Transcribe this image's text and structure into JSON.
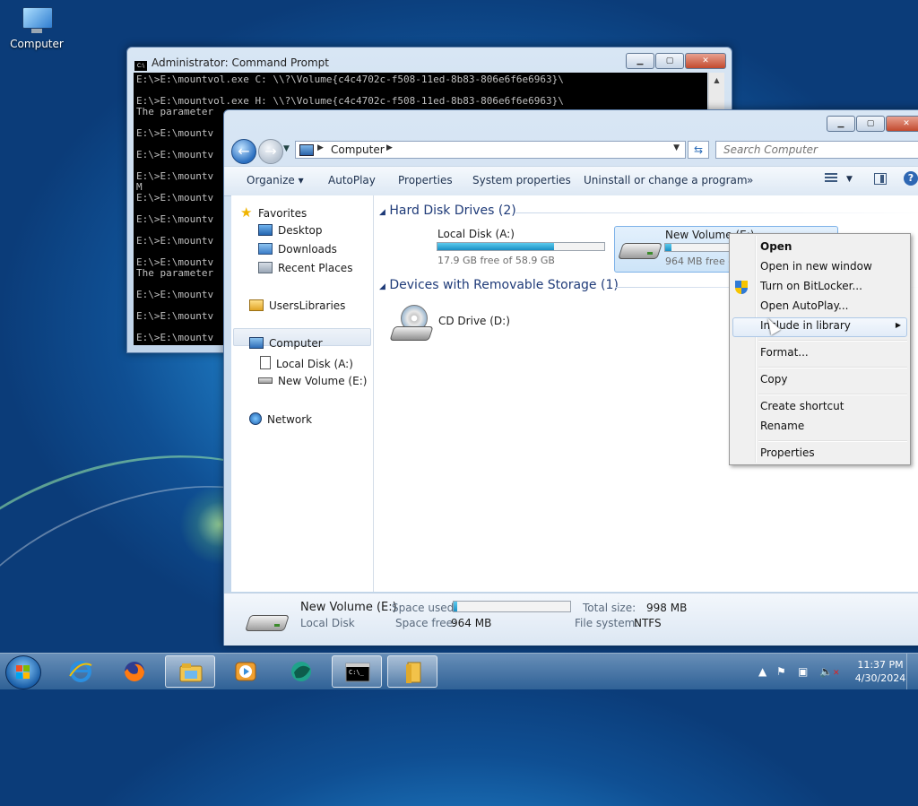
{
  "desktop": {
    "icons": [
      {
        "label": "Computer",
        "icon": "computer-icon"
      }
    ]
  },
  "cmd": {
    "title": "Administrator: Command Prompt",
    "lines": [
      "E:\\>E:\\mountvol.exe C: \\\\?\\Volume{c4c4702c-f508-11ed-8b83-806e6f6e6963}\\",
      "",
      "E:\\>E:\\mountvol.exe H: \\\\?\\Volume{c4c4702c-f508-11ed-8b83-806e6f6e6963}\\",
      "The parameter",
      "",
      "E:\\>E:\\mountv",
      "",
      "E:\\>E:\\mountv",
      "",
      "E:\\>E:\\mountv",
      "M",
      "E:\\>E:\\mountv",
      "",
      "E:\\>E:\\mountv",
      "",
      "E:\\>E:\\mountv",
      "",
      "E:\\>E:\\mountv",
      "The parameter",
      "",
      "E:\\>E:\\mountv",
      "",
      "E:\\>E:\\mountv",
      "",
      "E:\\>E:\\mountv"
    ]
  },
  "explorer": {
    "address": "Computer",
    "search_placeholder": "Search Computer",
    "toolbar": {
      "organize": "Organize",
      "autoplay": "AutoPlay",
      "properties": "Properties",
      "system_properties": "System properties",
      "uninstall": "Uninstall or change a program",
      "more": "»"
    },
    "nav": {
      "favorites": "Favorites",
      "desktop": "Desktop",
      "downloads": "Downloads",
      "recent": "Recent Places",
      "libraries": "UsersLibraries",
      "computer": "Computer",
      "local_disk": "Local Disk (A:)",
      "new_volume": "New Volume (E:)",
      "network": "Network"
    },
    "groups": {
      "hdd": "Hard Disk Drives (2)",
      "removable": "Devices with Removable Storage (1)"
    },
    "drives": {
      "local_disk": {
        "name": "Local Disk (A:)",
        "free": "17.9 GB free of 58.9 GB",
        "used_fraction": 0.7
      },
      "new_volume": {
        "name": "New Volume (E:)",
        "free": "964 MB free o",
        "used_fraction": 0.04
      },
      "cd": {
        "name": "CD Drive (D:)"
      }
    },
    "details": {
      "name": "New Volume (E:)",
      "type": "Local Disk",
      "space_used_label": "Space used:",
      "space_free_label": "Space free:",
      "space_free": "964 MB",
      "total_label": "Total size:",
      "total": "998 MB",
      "fs_label": "File system:",
      "fs": "NTFS",
      "used_fraction": 0.03
    }
  },
  "context_menu": {
    "items": [
      {
        "label": "Open"
      },
      {
        "label": "Open in new window"
      },
      {
        "label": "Turn on BitLocker..."
      },
      {
        "label": "Open AutoPlay..."
      },
      {
        "label": "Include in library"
      },
      {
        "label": "Format..."
      },
      {
        "label": "Copy"
      },
      {
        "label": "Create shortcut"
      },
      {
        "label": "Rename"
      },
      {
        "label": "Properties"
      }
    ]
  },
  "taskbar": {
    "time": "11:37 PM",
    "date": "4/30/2024"
  }
}
